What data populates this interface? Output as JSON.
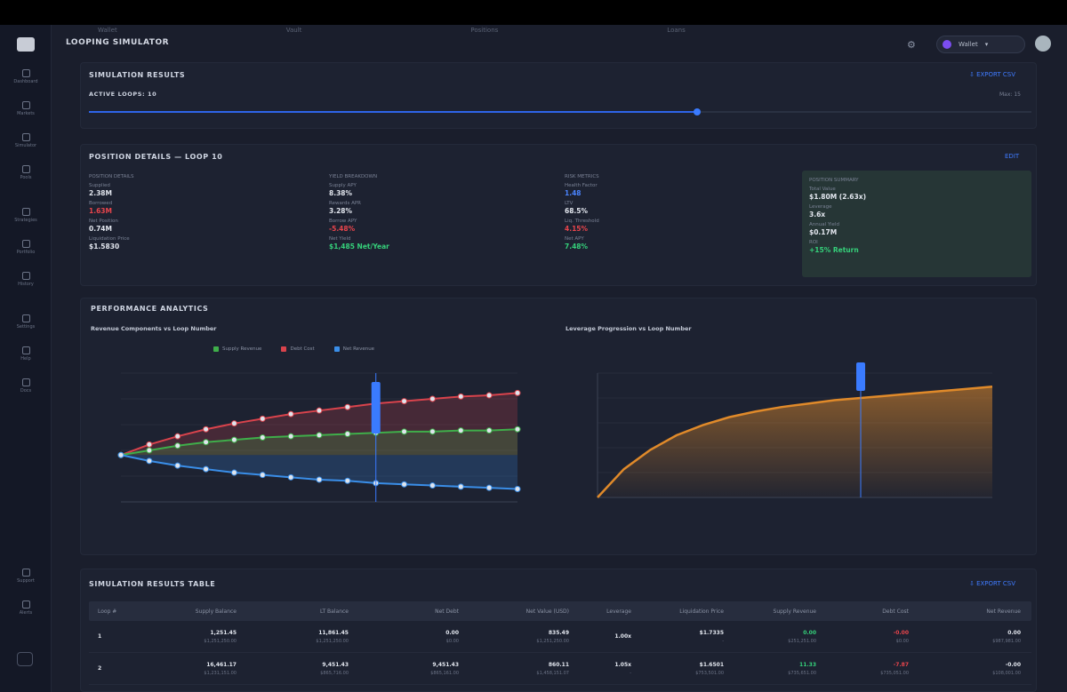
{
  "topnav": [
    "Wallet",
    "Vault",
    "Positions",
    "Loans"
  ],
  "sidebar": {
    "items": [
      {
        "icon": "dashboard-icon",
        "label": "Dashboard"
      },
      {
        "icon": "markets-icon",
        "label": "Markets"
      },
      {
        "icon": "simulator-icon",
        "label": "Simulator"
      },
      {
        "icon": "pools-icon",
        "label": "Pools"
      },
      {
        "icon": "strategies-icon",
        "label": "Strategies"
      },
      {
        "icon": "portfolio-icon",
        "label": "Portfolio"
      },
      {
        "icon": "history-icon",
        "label": "History"
      },
      {
        "icon": "settings-icon",
        "label": "Settings"
      },
      {
        "icon": "help-icon",
        "label": "Help"
      },
      {
        "icon": "docs-icon",
        "label": "Docs"
      },
      {
        "icon": "support-icon",
        "label": "Support"
      },
      {
        "icon": "alerts-icon",
        "label": "Alerts"
      }
    ]
  },
  "header": {
    "title": "LOOPING SIMULATOR",
    "wallet_label": "Wallet",
    "wallet_caret": "▾"
  },
  "results": {
    "title": "SIMULATION RESULTS",
    "export_label": "EXPORT CSV",
    "active_loops_label": "ACTIVE LOOPS: 10",
    "max_label": "Max: 15",
    "slider_fraction": 0.645
  },
  "details": {
    "title": "POSITION DETAILS — LOOP 10",
    "edit_label": "EDIT",
    "col1": [
      {
        "label": "POSITION DETAILS"
      },
      {
        "label": "Supplied",
        "value": "2.38M"
      },
      {
        "label": "Borrowed",
        "value": "1.63M",
        "tone": "red"
      },
      {
        "label": "Net Position",
        "value": "0.74M"
      },
      {
        "label": "Liquidation Price",
        "value": "$1.5830"
      }
    ],
    "col2": [
      {
        "label": "YIELD BREAKDOWN"
      },
      {
        "label": "Supply APY",
        "value": "8.38%"
      },
      {
        "label": "Rewards APR",
        "value": "3.28%"
      },
      {
        "label": "Borrow APY",
        "value": "-5.48%",
        "tone": "red"
      },
      {
        "label": "Net Yield",
        "value": "$1,485 Net/Year",
        "tone": "green"
      }
    ],
    "col3": [
      {
        "label": "RISK METRICS"
      },
      {
        "label": "Health Factor",
        "value": "1.48",
        "tone": "blue"
      },
      {
        "label": "LTV",
        "value": "68.5%"
      },
      {
        "label": "Liq. Threshold",
        "value": "4.15%",
        "tone": "red"
      },
      {
        "label": "Net APY",
        "value": "7.48%",
        "tone": "green"
      }
    ],
    "col4": [
      {
        "label": "POSITION SUMMARY"
      },
      {
        "label": "Total Value",
        "value": "$1.80M (2.63x)"
      },
      {
        "label": "Leverage",
        "value": "3.6x"
      },
      {
        "label": "Annual Yield",
        "value": "$0.17M"
      },
      {
        "label": "ROI",
        "value": "+15% Return",
        "tone": "green"
      }
    ]
  },
  "analytics": {
    "title": "PERFORMANCE ANALYTICS",
    "chart1_title": "Revenue Components vs Loop Number",
    "chart2_title": "Leverage Progression vs Loop Number",
    "legend": [
      {
        "label": "Supply Revenue",
        "color": "#3fae4a"
      },
      {
        "label": "Debt Cost",
        "color": "#d9434c"
      },
      {
        "label": "Net Revenue",
        "color": "#3a8ee8"
      }
    ]
  },
  "chart_data": [
    {
      "type": "line",
      "title": "Revenue Components vs Loop Number",
      "x": [
        1,
        2,
        3,
        4,
        5,
        6,
        7,
        8,
        9,
        10,
        11,
        12,
        13,
        14,
        15
      ],
      "series": [
        {
          "name": "Debt Cost",
          "color": "#d9434c",
          "values": [
            0,
            0.09,
            0.16,
            0.22,
            0.27,
            0.31,
            0.35,
            0.38,
            0.41,
            0.44,
            0.46,
            0.48,
            0.5,
            0.51,
            0.53
          ]
        },
        {
          "name": "Supply Revenue",
          "color": "#3fae4a",
          "values": [
            0,
            0.04,
            0.08,
            0.11,
            0.13,
            0.15,
            0.16,
            0.17,
            0.18,
            0.19,
            0.2,
            0.2,
            0.21,
            0.21,
            0.22
          ]
        },
        {
          "name": "Net Revenue",
          "color": "#3a8ee8",
          "values": [
            0,
            -0.05,
            -0.09,
            -0.12,
            -0.15,
            -0.17,
            -0.19,
            -0.21,
            -0.22,
            -0.24,
            -0.25,
            -0.26,
            -0.27,
            -0.28,
            -0.29
          ]
        }
      ],
      "highlight_x": 10,
      "ylim": [
        -0.4,
        0.7
      ]
    },
    {
      "type": "area",
      "title": "Leverage Progression vs Loop Number",
      "x": [
        0,
        1,
        2,
        3,
        4,
        5,
        6,
        7,
        8,
        9,
        10,
        11,
        12,
        13,
        14,
        15
      ],
      "series": [
        {
          "name": "Leverage",
          "color": "#e08a2a",
          "values": [
            0,
            0.25,
            0.42,
            0.55,
            0.64,
            0.71,
            0.76,
            0.8,
            0.83,
            0.86,
            0.88,
            0.9,
            0.92,
            0.94,
            0.96,
            0.98
          ]
        }
      ],
      "highlight_x": 10,
      "ylim": [
        0,
        1.1
      ]
    }
  ],
  "table": {
    "title": "SIMULATION RESULTS TABLE",
    "export_label": "EXPORT CSV",
    "headers": [
      "Loop #",
      "Supply Balance",
      "LT Balance",
      "Net Debt",
      "Net Value (USD)",
      "Leverage",
      "Liquidation Price",
      "Supply Revenue",
      "Debt Cost",
      "Net Revenue"
    ],
    "rows": [
      {
        "cells": [
          "1",
          "1,251.45",
          "11,861.45",
          "0.00",
          "835.49",
          "1.00x",
          "$1.7335",
          "0.00",
          "-0.00",
          "0.00"
        ],
        "subs": [
          "",
          "$1,251,250.00",
          "$1,251,250.00",
          "$0.00",
          "$1,251,250.00",
          "",
          "-",
          "$251,251.00",
          "$0.00",
          "$987,981.00"
        ],
        "tones": [
          "",
          "",
          "",
          "",
          "",
          "",
          "",
          "green",
          "red",
          ""
        ]
      },
      {
        "cells": [
          "2",
          "16,461.17",
          "9,451.43",
          "9,451.43",
          "860.11",
          "1.05x",
          "$1.6501",
          "11.33",
          "-7.87",
          "-0.00"
        ],
        "subs": [
          "",
          "$1,231,151.00",
          "$865,716.00",
          "$865,161.00",
          "$1,458,151.07",
          "-",
          "$753,501.00",
          "$735,651.00",
          "$735,051.00",
          "$108,001.00"
        ],
        "tones": [
          "",
          "",
          "",
          "",
          "",
          "",
          "",
          "green",
          "red",
          ""
        ]
      }
    ]
  }
}
